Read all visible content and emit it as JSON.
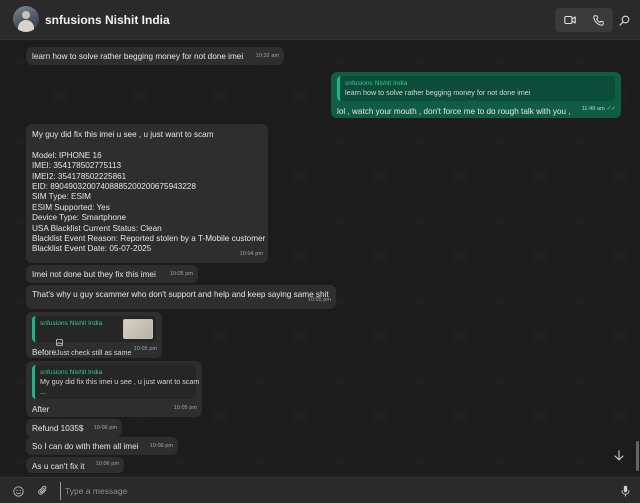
{
  "header": {
    "contact_name": "snfusions Nishit India",
    "video_icon": "video-camera-icon",
    "call_icon": "phone-icon",
    "search_icon": "search-icon"
  },
  "messages": [
    {
      "direction": "in",
      "text": "learn how to solve rather begging money for not done imei",
      "time": "10:32 am"
    },
    {
      "direction": "out",
      "quote_author": "snfusions Nishit India",
      "quote_text": "learn how to solve rather begging money for not done imei",
      "text": "lol , watch your mouth , don't force me to do rough talk with you ,",
      "time": "11:49 am"
    },
    {
      "direction": "in",
      "text": "My guy did fix this imei u see , u just want to scam\n\nModel: IPHONE 16\nIMEI: 354178502775113\nIMEI2: 354178502225861\nEID: 89049032007408885200200675943228\nSIM Type: ESIM\nESIM Supported: Yes\nDevice Type: Smartphone\nUSA Blacklist Current Status: Clean\nBlacklist Event Reason: Reported stolen by a T-Mobile customer\nBlacklist Event Date: 05-07-2025",
      "time": "10:04 pm"
    },
    {
      "direction": "in",
      "text": "Imei not done but they fix this imei",
      "time": "10:05 pm"
    },
    {
      "direction": "in",
      "text": "That's why u guy scammer who don't support and help and keep saying same shit",
      "time": "10:05 pm"
    },
    {
      "direction": "in",
      "quote_author": "snfusions Nishit India",
      "quote_text": "Just check still as same",
      "quote_icon": "image-icon",
      "text": "Before",
      "time": "10:05 pm"
    },
    {
      "direction": "in",
      "quote_author": "snfusions Nishit India",
      "quote_text": "My guy did fix this imei u see , u just want to scam\n...",
      "text": "After",
      "time": "10:05 pm"
    },
    {
      "direction": "in",
      "text": "Refund 1035$",
      "time": "10:06 pm"
    },
    {
      "direction": "in",
      "text": "So I can do with them all imei",
      "time": "10:06 pm"
    },
    {
      "direction": "in",
      "text": "As u can't fix it",
      "time": "10:06 pm"
    }
  ],
  "composer": {
    "placeholder": "Type a message",
    "emoji_icon": "emoji-icon",
    "attach_icon": "paperclip-icon",
    "mic_icon": "microphone-icon"
  },
  "colors": {
    "accent": "#14b88a",
    "outgoing_bubble": "#0f5d45",
    "incoming_bubble": "#2e2e2e"
  }
}
